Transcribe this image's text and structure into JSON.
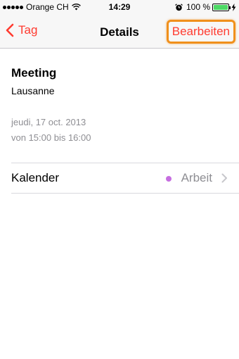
{
  "status_bar": {
    "carrier": "Orange CH",
    "time": "14:29",
    "battery_percent": "100 %",
    "battery_level": 1.0,
    "icons": [
      "signal-dots-icon",
      "wifi-icon",
      "alarm-icon",
      "battery-icon",
      "bolt-icon"
    ]
  },
  "navbar": {
    "back_label": "Tag",
    "title": "Details",
    "edit_label": "Bearbeiten"
  },
  "event": {
    "title": "Meeting",
    "location": "Lausanne",
    "date": "jeudi, 17 oct. 2013",
    "time_range": "von 15:00 bis 16:00"
  },
  "calendar_row": {
    "label": "Kalender",
    "value": "Arbeit",
    "dot_color": "#c66ee0"
  },
  "colors": {
    "accent": "#ff3b30",
    "highlight_border": "#f0901c",
    "secondary_text": "#8e8e93"
  }
}
